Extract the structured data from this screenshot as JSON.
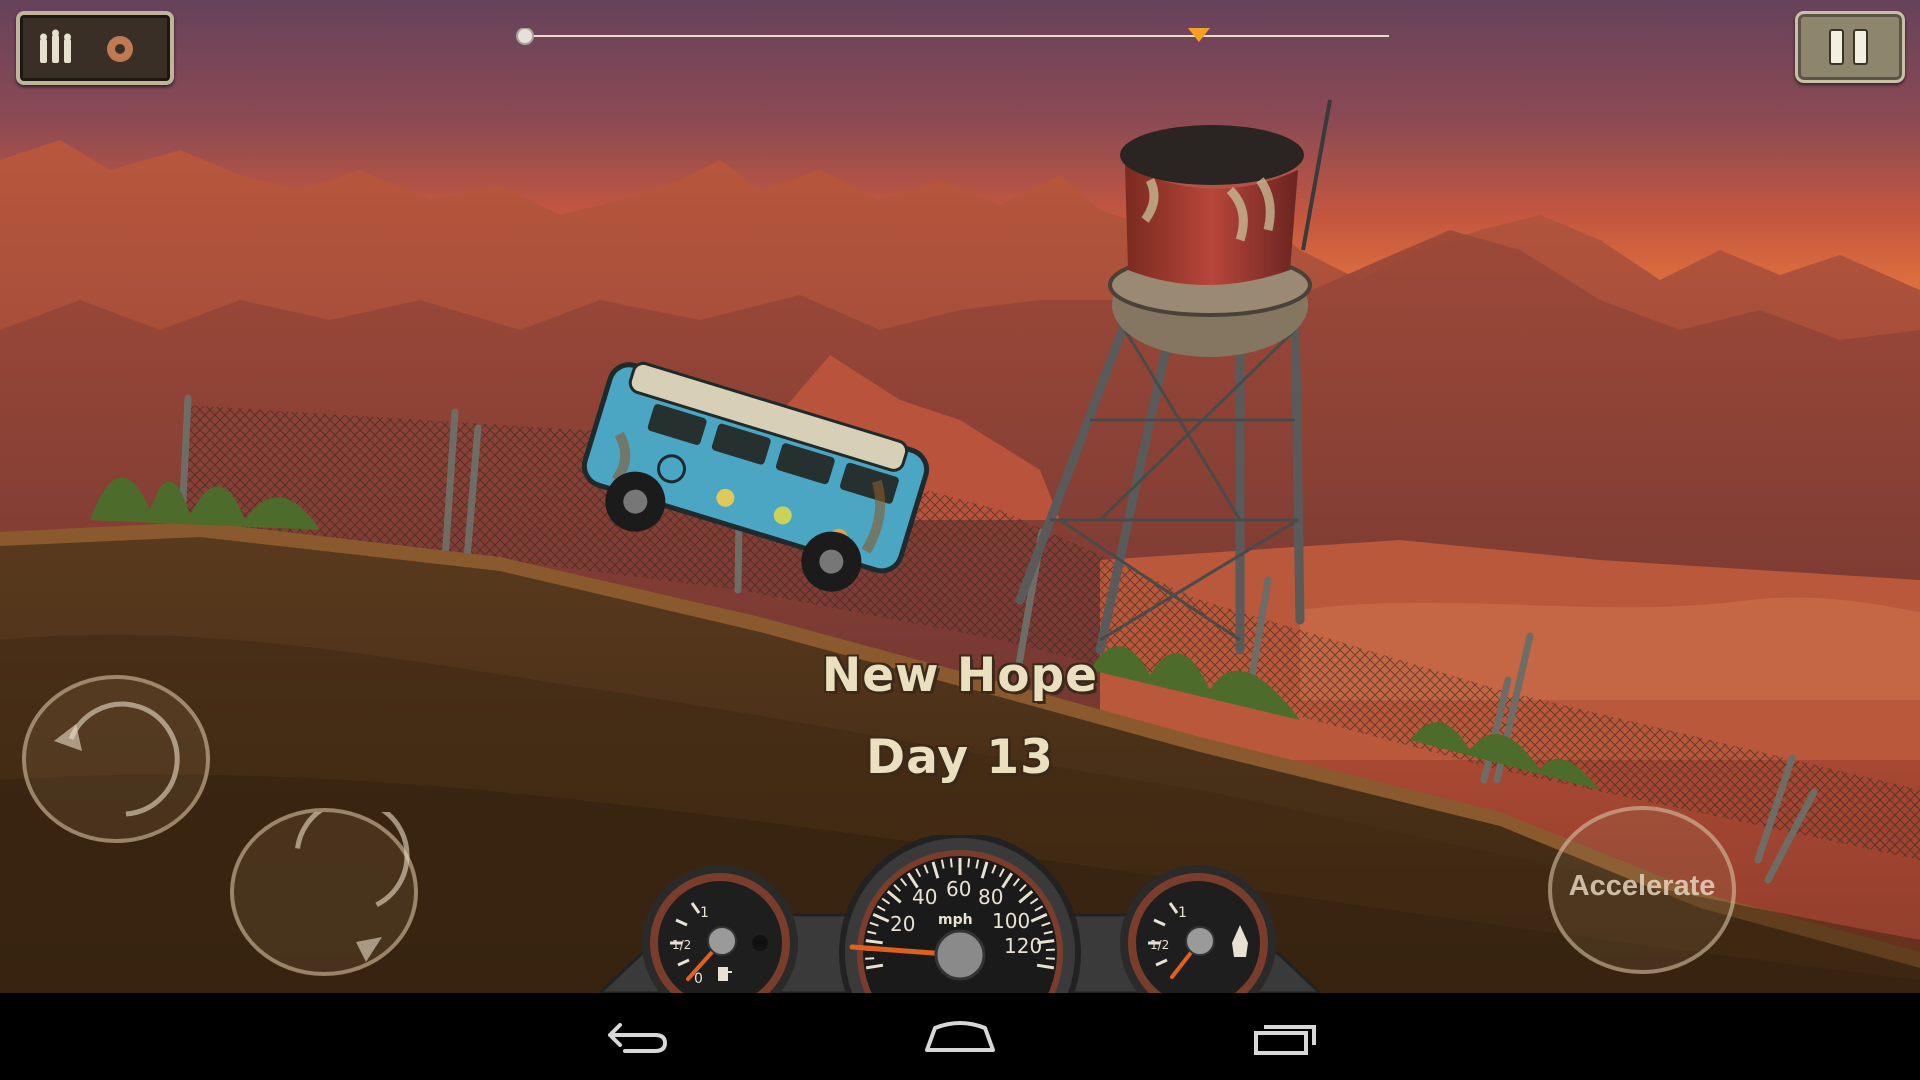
{
  "game": {
    "location_name": "New Hope",
    "day_label": "Day 13"
  },
  "hud": {
    "ammo_icon": "bullets-icon",
    "settings_icon": "gear-icon",
    "pause_icon": "pause-icon",
    "progress": {
      "current_fraction": 0.0,
      "checkpoint_fraction": 0.78
    }
  },
  "controls": {
    "tilt_back_icon": "rotate-counterclockwise-icon",
    "tilt_forward_icon": "rotate-clockwise-icon",
    "accelerate_label": "Accelerate"
  },
  "dashboard": {
    "fuel_gauge": {
      "labels": [
        "1",
        "1/2",
        "0"
      ],
      "icon": "fuel-pump-icon",
      "level_fraction": 0.05
    },
    "speedometer": {
      "unit": "mph",
      "tick_labels": [
        "20",
        "40",
        "60",
        "80",
        "100",
        "120"
      ],
      "speed": 0
    },
    "boost_gauge": {
      "labels": [
        "1",
        "1/2"
      ],
      "icon": "rocket-icon",
      "level_fraction": 0.15
    }
  },
  "navbar": {
    "back_icon": "back-icon",
    "home_icon": "home-icon",
    "recents_icon": "recent-apps-icon"
  },
  "colors": {
    "sky_top": "#6f4660",
    "sky_horizon": "#d9603a",
    "ground": "#4a3019",
    "text": "#eadfbf",
    "bus": "#4aa6c2"
  }
}
